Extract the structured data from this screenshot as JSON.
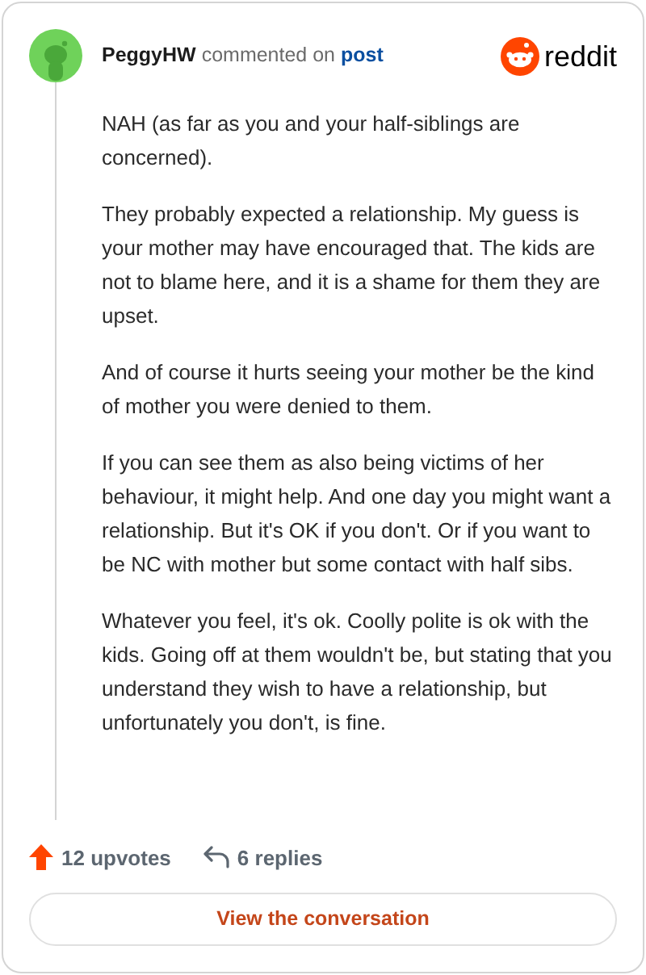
{
  "author": "PeggyHW",
  "action": "commented on",
  "target": "post",
  "brand": "reddit",
  "paragraphs": [
    "NAH (as far as you and your half-siblings are concerned).",
    "They probably expected a relationship. My guess is your mother may have encouraged that. The kids are not to blame here, and it is a shame for them they are upset.",
    "And of course it hurts seeing your mother be the kind of mother you were denied to them.",
    "If you can see them as also being victims of her behaviour, it might help. And one day you might want a relationship. But it's OK if you don't. Or if you want to be NC with mother but some contact with half sibs.",
    "Whatever you feel, it's ok. Coolly polite is ok with the kids. Going off at them wouldn't be, but stating that you understand they wish to have a relationship, but unfortunately you don't, is fine."
  ],
  "upvotes": "12 upvotes",
  "replies": "6 replies",
  "button": "View the conversation"
}
